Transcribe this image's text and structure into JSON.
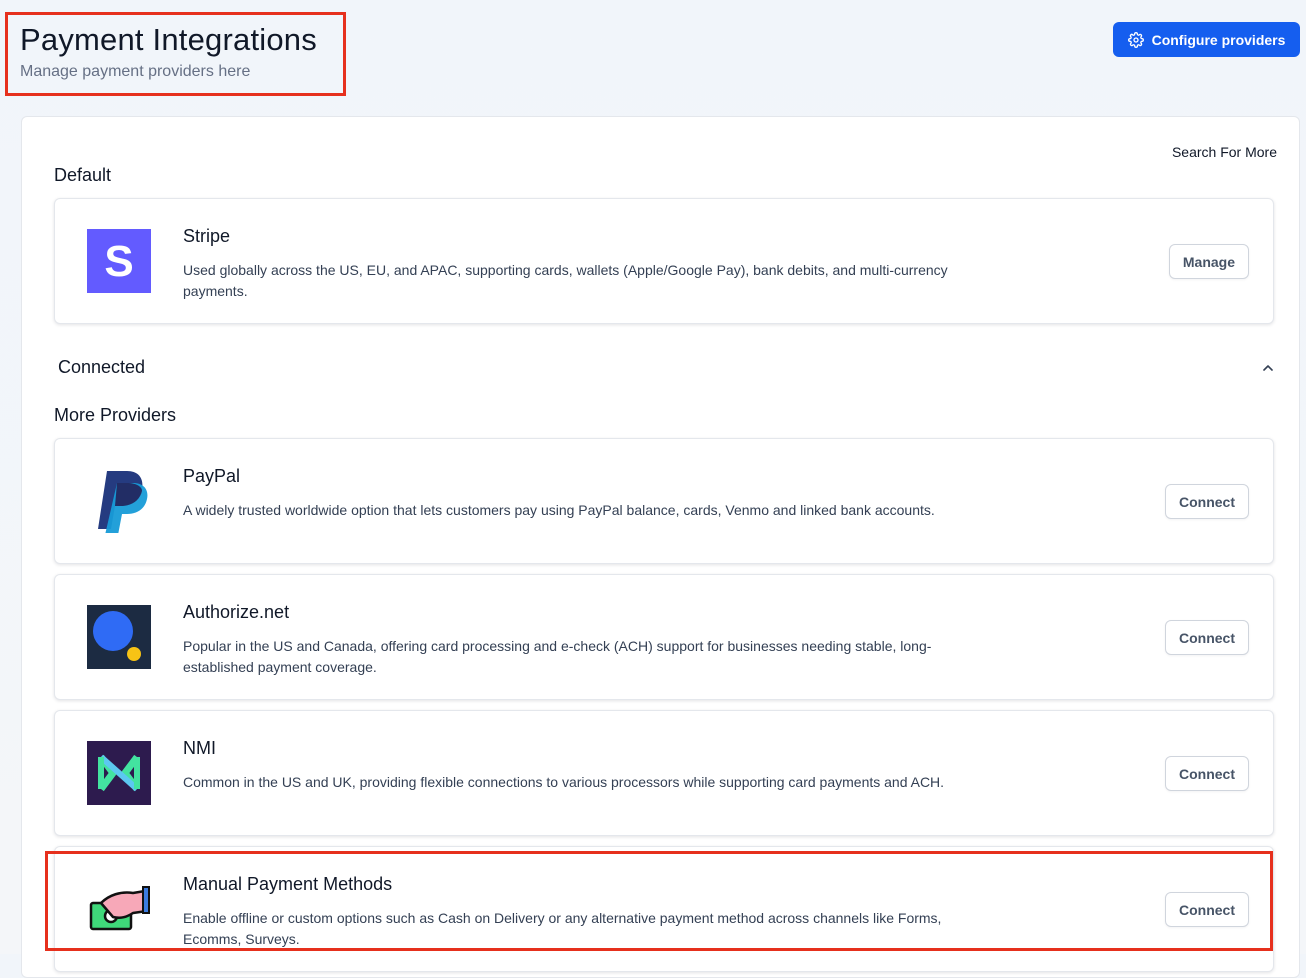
{
  "header": {
    "title": "Payment Integrations",
    "subtitle": "Manage payment providers here",
    "configure_label": "Configure providers"
  },
  "panel": {
    "search_more": "Search For More",
    "sections": {
      "default": "Default",
      "connected": "Connected",
      "more": "More Providers"
    }
  },
  "providers": {
    "stripe": {
      "name": "Stripe",
      "desc": "Used globally across the US, EU, and APAC, supporting cards, wallets (Apple/Google Pay), bank debits, and multi-currency payments.",
      "action": "Manage",
      "logo_letter": "S",
      "logo_color": "#635bff"
    },
    "paypal": {
      "name": "PayPal",
      "desc": "A widely trusted worldwide option that lets customers pay using PayPal balance, cards, Venmo and linked bank accounts.",
      "action": "Connect"
    },
    "authorize": {
      "name": "Authorize.net",
      "desc": "Popular in the US and Canada, offering card processing and e-check (ACH) support for businesses needing stable, long-established payment coverage.",
      "action": "Connect"
    },
    "nmi": {
      "name": "NMI",
      "desc": "Common in the US and UK, providing flexible connections to various processors while supporting card payments and ACH.",
      "action": "Connect"
    },
    "manual": {
      "name": "Manual Payment Methods",
      "desc": "Enable offline or custom options such as Cash on Delivery or any alternative payment method across channels like Forms, Ecomms, Surveys.",
      "action": "Connect"
    }
  },
  "colors": {
    "primary": "#155eef",
    "highlight": "#e6301d"
  }
}
